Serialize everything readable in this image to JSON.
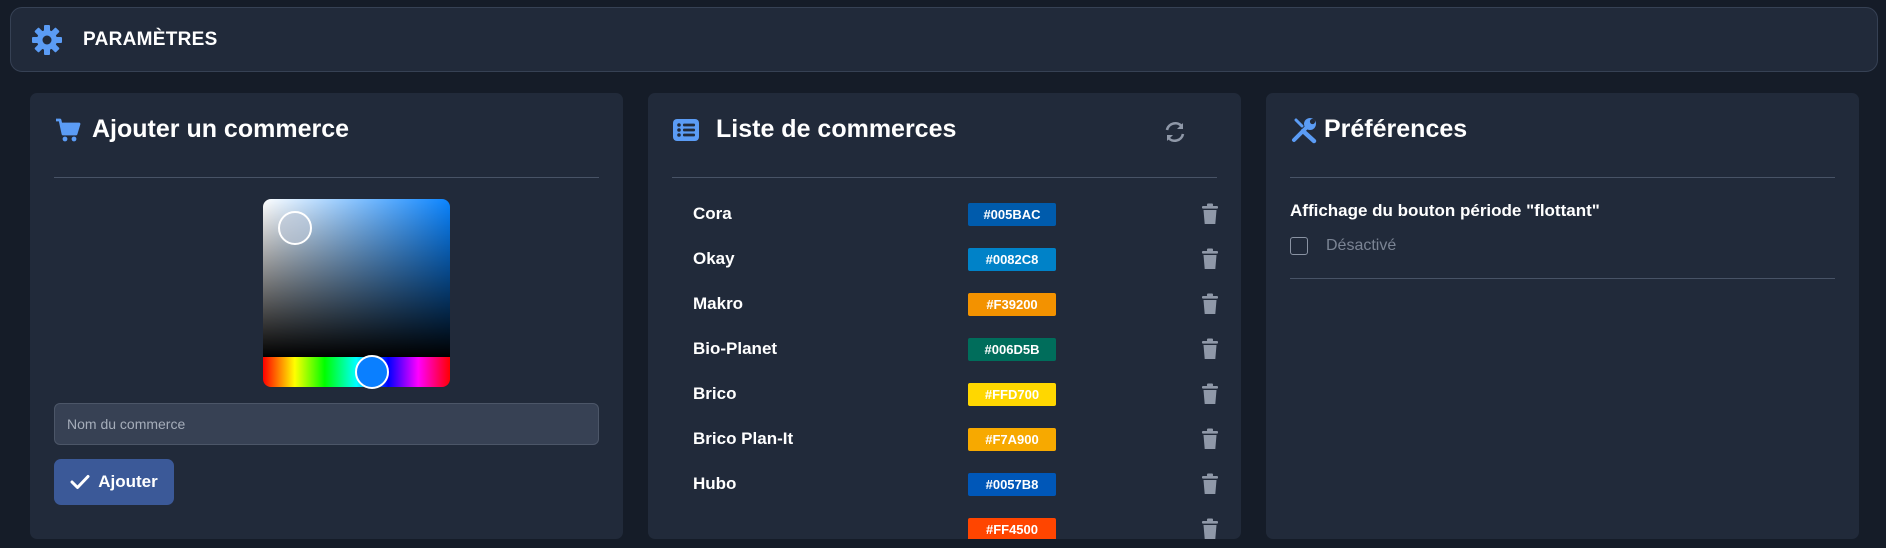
{
  "header": {
    "title": "PARAMÈTRES",
    "icon": "gear-icon"
  },
  "add_panel": {
    "title": "Ajouter un commerce",
    "icon": "shopping-cart-icon",
    "name_placeholder": "Nom du commerce",
    "add_label": "Ajouter",
    "picker_color": "#0A84FF"
  },
  "list_panel": {
    "title": "Liste de commerces",
    "icon": "list-icon",
    "items": [
      {
        "name": "Cora",
        "color": "#005BAC"
      },
      {
        "name": "Okay",
        "color": "#0082C8"
      },
      {
        "name": "Makro",
        "color": "#F39200"
      },
      {
        "name": "Bio-Planet",
        "color": "#006D5B"
      },
      {
        "name": "Brico",
        "color": "#FFD700"
      },
      {
        "name": "Brico Plan-It",
        "color": "#F7A900"
      },
      {
        "name": "Hubo",
        "color": "#0057B8"
      },
      {
        "name": "",
        "color": "#FF4500"
      }
    ]
  },
  "prefs_panel": {
    "title": "Préférences",
    "icon": "tools-icon",
    "option_label": "Affichage du bouton période \"flottant\"",
    "option_state": "Désactivé"
  }
}
